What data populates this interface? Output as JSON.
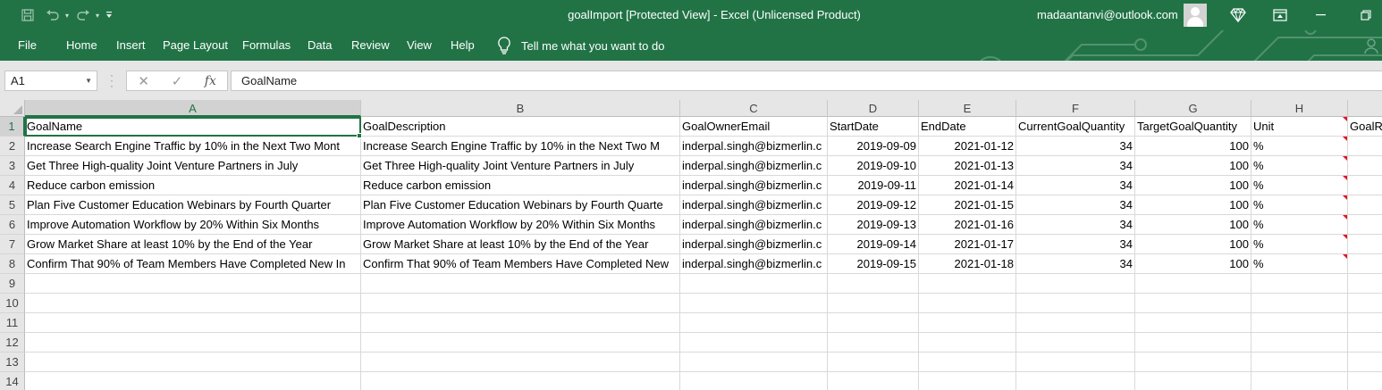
{
  "titlebar": {
    "title": "goalImport  [Protected View]  -  Excel (Unlicensed Product)",
    "account": "madaantanvi@outlook.com",
    "qat_icons": [
      "save-icon",
      "undo-icon",
      "redo-icon",
      "customize-qat-icon"
    ]
  },
  "ribbon": {
    "tabs": [
      "File",
      "Home",
      "Insert",
      "Page Layout",
      "Formulas",
      "Data",
      "Review",
      "View",
      "Help"
    ],
    "tell_me": "Tell me what you want to do"
  },
  "formula_bar": {
    "name_box": "A1",
    "value": "GoalName"
  },
  "sheet": {
    "columns": [
      "A",
      "B",
      "C",
      "D",
      "E",
      "F",
      "G",
      "H"
    ],
    "row_numbers": [
      "1",
      "2",
      "3",
      "4",
      "5",
      "6",
      "7",
      "8",
      "9",
      "10",
      "11",
      "12",
      "13",
      "14"
    ],
    "header_row": [
      "GoalName",
      "GoalDescription",
      "GoalOwnerEmail",
      "StartDate",
      "EndDate",
      "CurrentGoalQuantity",
      "TargetGoalQuantity",
      "Unit",
      "GoalR"
    ],
    "rows": [
      [
        "Increase Search Engine Traffic by 10% in the Next Two Mont",
        "Increase Search Engine Traffic by 10% in the Next Two M",
        "inderpal.singh@bizmerlin.c",
        "2019-09-09",
        "2021-01-12",
        "34",
        "100",
        "%"
      ],
      [
        "Get Three High-quality Joint Venture Partners in July",
        "Get Three High-quality Joint Venture Partners in July",
        "inderpal.singh@bizmerlin.c",
        "2019-09-10",
        "2021-01-13",
        "34",
        "100",
        "%"
      ],
      [
        "Reduce carbon emission",
        "Reduce carbon emission",
        "inderpal.singh@bizmerlin.c",
        "2019-09-11",
        "2021-01-14",
        "34",
        "100",
        "%"
      ],
      [
        "Plan Five Customer Education Webinars by Fourth Quarter",
        "Plan Five Customer Education Webinars by Fourth Quarte",
        "inderpal.singh@bizmerlin.c",
        "2019-09-12",
        "2021-01-15",
        "34",
        "100",
        "%"
      ],
      [
        "Improve Automation Workflow by 20% Within Six Months",
        "Improve Automation Workflow by 20% Within Six Months",
        "inderpal.singh@bizmerlin.c",
        "2019-09-13",
        "2021-01-16",
        "34",
        "100",
        "%"
      ],
      [
        "Grow Market Share at least 10% by the End of the Year",
        "Grow Market Share at least 10% by the End of the Year",
        "inderpal.singh@bizmerlin.c",
        "2019-09-14",
        "2021-01-17",
        "34",
        "100",
        "%"
      ],
      [
        "Confirm That 90% of Team Members Have Completed New In",
        "Confirm That 90% of Team Members Have Completed New",
        "inderpal.singh@bizmerlin.c",
        "2019-09-15",
        "2021-01-18",
        "34",
        "100",
        "%"
      ]
    ]
  },
  "colors": {
    "excel_green": "#217346",
    "comment_indicator": "#e81123"
  }
}
